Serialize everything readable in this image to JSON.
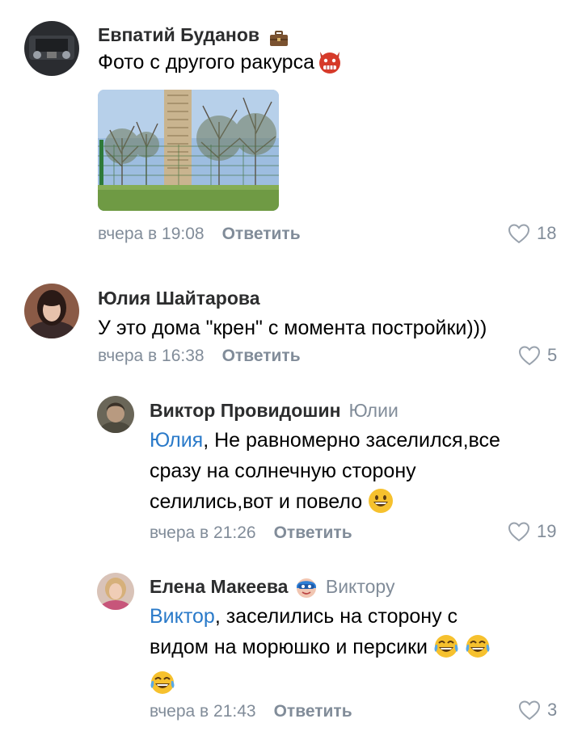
{
  "comments": [
    {
      "author": "Евпатий Буданов",
      "badge_icon": "briefcase-icon",
      "text": "Фото с другого ракурса",
      "text_emoji": "devil-face-icon",
      "photo_icon": "photo-trees-building",
      "time": "вчера в 19:08",
      "reply_label": "Ответить",
      "likes": "18"
    },
    {
      "author": "Юлия Шайтарова",
      "text": "У это дома \"крен\" с момента постройки)))",
      "time": "вчера в 16:38",
      "reply_label": "Ответить",
      "likes": "5"
    },
    {
      "author": "Виктор Провидошин",
      "reply_to": "Юлии",
      "mention": "Юлия",
      "line1_rest": ", Не равномерно заселился,все",
      "line2": "сразу на солнечную сторону",
      "line3": "селились,вот и повело",
      "text_emoji": "grinning-face-icon",
      "time": "вчера в 21:26",
      "reply_label": "Ответить",
      "likes": "19"
    },
    {
      "author": "Елена Макеева",
      "badge_icon": "superhero-mask-icon",
      "reply_to": "Виктору",
      "mention": "Виктор",
      "line1_rest": ", заселились на сторону с",
      "line2": "видом на морюшко и персики",
      "text_emoji": "tears-of-joy-icon",
      "time": "вчера в 21:43",
      "reply_label": "Ответить",
      "likes": "3"
    }
  ],
  "colors": {
    "link": "#2a7ac9",
    "secondary": "#818c99",
    "name": "#2c2d2e"
  }
}
